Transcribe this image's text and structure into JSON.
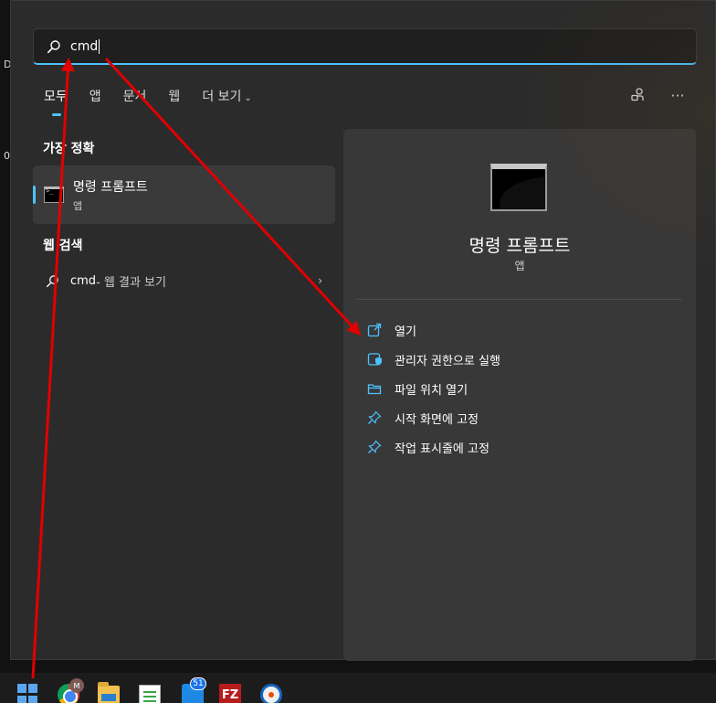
{
  "desktop": {
    "glyph_top": "D",
    "glyph_mid": "0"
  },
  "search": {
    "value": "cmd"
  },
  "tabs": [
    {
      "label": "모두",
      "active": true
    },
    {
      "label": "앱"
    },
    {
      "label": "문서"
    },
    {
      "label": "웹"
    },
    {
      "label": "더 보기"
    }
  ],
  "tools": {
    "share_icon": "share-icon",
    "more_icon": "more-icon",
    "more_glyph": "···"
  },
  "best_match": {
    "title": "가장 정확",
    "name": "명령 프롬프트",
    "type": "앱"
  },
  "web_search": {
    "title": "웹 검색",
    "query": "cmd",
    "suffix": " - 웹 결과 보기",
    "arrow": "›"
  },
  "preview": {
    "name": "명령 프롬프트",
    "type": "앱",
    "actions": [
      {
        "label": "열기",
        "icon": "open-icon"
      },
      {
        "label": "관리자 권한으로 실행",
        "icon": "shield-icon"
      },
      {
        "label": "파일 위치 열기",
        "icon": "folder-icon"
      },
      {
        "label": "시작 화면에 고정",
        "icon": "pin-icon"
      },
      {
        "label": "작업 표시줄에 고정",
        "icon": "pin-icon"
      }
    ]
  },
  "taskbar": {
    "chrome_badge": "M",
    "mail_badge": "51",
    "filezilla_glyph": "FZ"
  },
  "colors": {
    "accent": "#4cc2ff",
    "arrow": "#e10000"
  }
}
